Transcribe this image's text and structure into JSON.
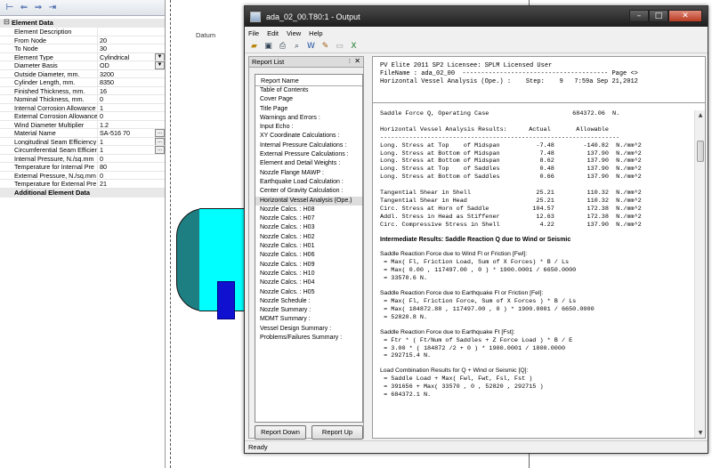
{
  "prop_panel": {
    "toolbar_icons": [
      "node-jump-icon",
      "arrow-left-icon",
      "arrow-right-icon",
      "last-node-icon"
    ],
    "section_title": "Element Data",
    "section2_title": "Additional Element Data",
    "rows": [
      {
        "label": "Element Description",
        "value": ""
      },
      {
        "label": "From Node",
        "value": "20"
      },
      {
        "label": "To Node",
        "value": "30"
      },
      {
        "label": "Element Type",
        "value": "Cylindrical",
        "control": "dropdown"
      },
      {
        "label": "Diameter Basis",
        "value": "OD",
        "control": "dropdown"
      },
      {
        "label": "Outside Diameter, mm.",
        "value": "3200"
      },
      {
        "label": "Cylinder Length, mm.",
        "value": "8350"
      },
      {
        "label": "Finished Thickness, mm.",
        "value": "16"
      },
      {
        "label": "Nominal Thickness,  mm.",
        "value": "0"
      },
      {
        "label": "Internal Corrosion Allowance",
        "value": "1"
      },
      {
        "label": "External Corrosion Allowance",
        "value": "0"
      },
      {
        "label": "Wind Diameter Multiplier",
        "value": "1.2"
      },
      {
        "label": "Material Name",
        "value": "SA-516 70",
        "control": "browse"
      },
      {
        "label": "Longitudinal Seam Efficiency",
        "value": "1",
        "control": "browse"
      },
      {
        "label": "Circumferential Seam Efficien",
        "value": "1",
        "control": "browse"
      },
      {
        "label": "Internal Pressure,  N./sq.mm",
        "value": "0"
      },
      {
        "label": "Temperature for Internal Pre",
        "value": "80"
      },
      {
        "label": "External Pressure,  N./sq.mm",
        "value": "0"
      },
      {
        "label": "Temperature for External Pre",
        "value": "21"
      }
    ]
  },
  "canvas": {
    "datum_label": "Datum"
  },
  "output_window": {
    "title": "ada_02_00.T80:1 - Output",
    "menu": [
      "File",
      "Edit",
      "View",
      "Help"
    ],
    "toolbar_icons": [
      "open-icon",
      "save-icon",
      "print-icon",
      "print-preview-icon",
      "word-export-icon",
      "edit-icon",
      "options-icon",
      "excel-export-icon"
    ],
    "report_list": {
      "pane_title": "Report List",
      "header": "Report Name",
      "selected": "Horizontal Vessel Analysis (Ope.)",
      "items": [
        "Table of Contents",
        "Cover Page",
        "Title Page",
        "Warnings and Errors :",
        "Input Echo :",
        "XY Coordinate Calculations :",
        "Internal Pressure Calculations :",
        "External Pressure Calculations :",
        "Element and Detail Weights :",
        "Nozzle Flange MAWP :",
        "Earthquake Load Calculation :",
        "Center of Gravity Calculation :",
        "Horizontal Vessel Analysis (Ope.)",
        "Nozzle Calcs. : H08",
        "Nozzle Calcs. : H07",
        "Nozzle Calcs. : H03",
        "Nozzle Calcs. : H02",
        "Nozzle Calcs. : H01",
        "Nozzle Calcs. : H06",
        "Nozzle Calcs. : H09",
        "Nozzle Calcs. : H10",
        "Nozzle Calcs. : H04",
        "Nozzle Calcs. : H05",
        "Nozzle Schedule :",
        "Nozzle Summary :",
        "MDMT Summary :",
        "Vessel Design Summary :",
        "Problems/Failures Summary :"
      ],
      "report_down": "Report Down",
      "report_up": "Report Up"
    },
    "report_header": [
      "PV Elite 2011 SP2 Licensee: SPLM Licensed User",
      "FileName : ada_02_00  --------------------------------------- Page <>",
      "Horizontal Vessel Analysis (Ope.) :    Step:    9   7:59a Sep 21,2012"
    ],
    "report_body": [
      "Saddle Force Q, Operating Case                       684372.06  N.",
      "",
      "Horizontal Vessel Analysis Results:      Actual       Allowable",
      "------------------------------------------------------------------",
      "Long. Stress at Top    of Midspan          -7.48        -140.82  N./mm^2",
      "Long. Stress at Bottom of Midspan           7.48         137.90  N./mm^2",
      "Long. Stress at Bottom of Midspan           8.62         137.90  N./mm^2",
      "Long. Stress at Top    of Saddles           0.48         137.90  N./mm^2",
      "Long. Stress at Bottom of Saddles           0.66         137.90  N./mm^2",
      "",
      "Tangential Shear in Shell                  25.21         110.32  N./mm^2",
      "Tangential Shear in Head                   25.21         110.32  N./mm^2",
      "Circ. Stress at Horn of Saddle            104.57         172.38  N./mm^2",
      "Addl. Stress in Head as Stiffener          12.63         172.38  N./mm^2",
      "Circ. Compressive Stress in Shell           4.22         137.90  N./mm^2"
    ],
    "sections": [
      {
        "title": "Intermediate Results: Saddle Reaction Q due to Wind or Seismic",
        "bold": true,
        "lines": []
      },
      {
        "title": "Saddle Reaction Force due to Wind Fl or Friction [Fwl]:",
        "lines": [
          " = Max( Fl, Friction Load, Sum of X Forces) * B / Ls",
          " = Max( 0.00 , 117497.00 , 0 ) * 1900.0001 / 6650.0000",
          " = 33570.6 N."
        ]
      },
      {
        "title": "Saddle Reaction Force due to Earthquake Fl or Friction [Fel]:",
        "lines": [
          " = Max( Fl, Friction Force, Sum of X Forces ) * B / Ls",
          " = Max( 184872.88 , 117497.00 , 0 ) * 1900.0001 / 6650.0000",
          " = 52820.8 N."
        ]
      },
      {
        "title": "Saddle Reaction Force due to Earthquake Ft [Fst]:",
        "lines": [
          " = Ftr * ( Ft/Num of Saddles + Z Force Load ) * B / E",
          " = 3.00 * ( 184872 /2 + 0 ) * 1900.0001 / 1800.0000",
          " = 292715.4 N."
        ]
      },
      {
        "title": "Load Combination Results for Q + Wind or Seismic [Q]:",
        "lines": [
          " = Saddle Load + Max( Fwl, Fwt, Fsl, Fst )",
          " = 391656 + Max( 33570 , 0 , 52820 , 292715 )",
          " = 684372.1 N."
        ]
      }
    ],
    "status": "Ready"
  },
  "colors": {
    "vessel_shell": "#00ffff",
    "vessel_head": "#1e7f82",
    "saddle": "#1010d0",
    "title_bar": "#2a2a2a",
    "close_button": "#c0472f"
  }
}
